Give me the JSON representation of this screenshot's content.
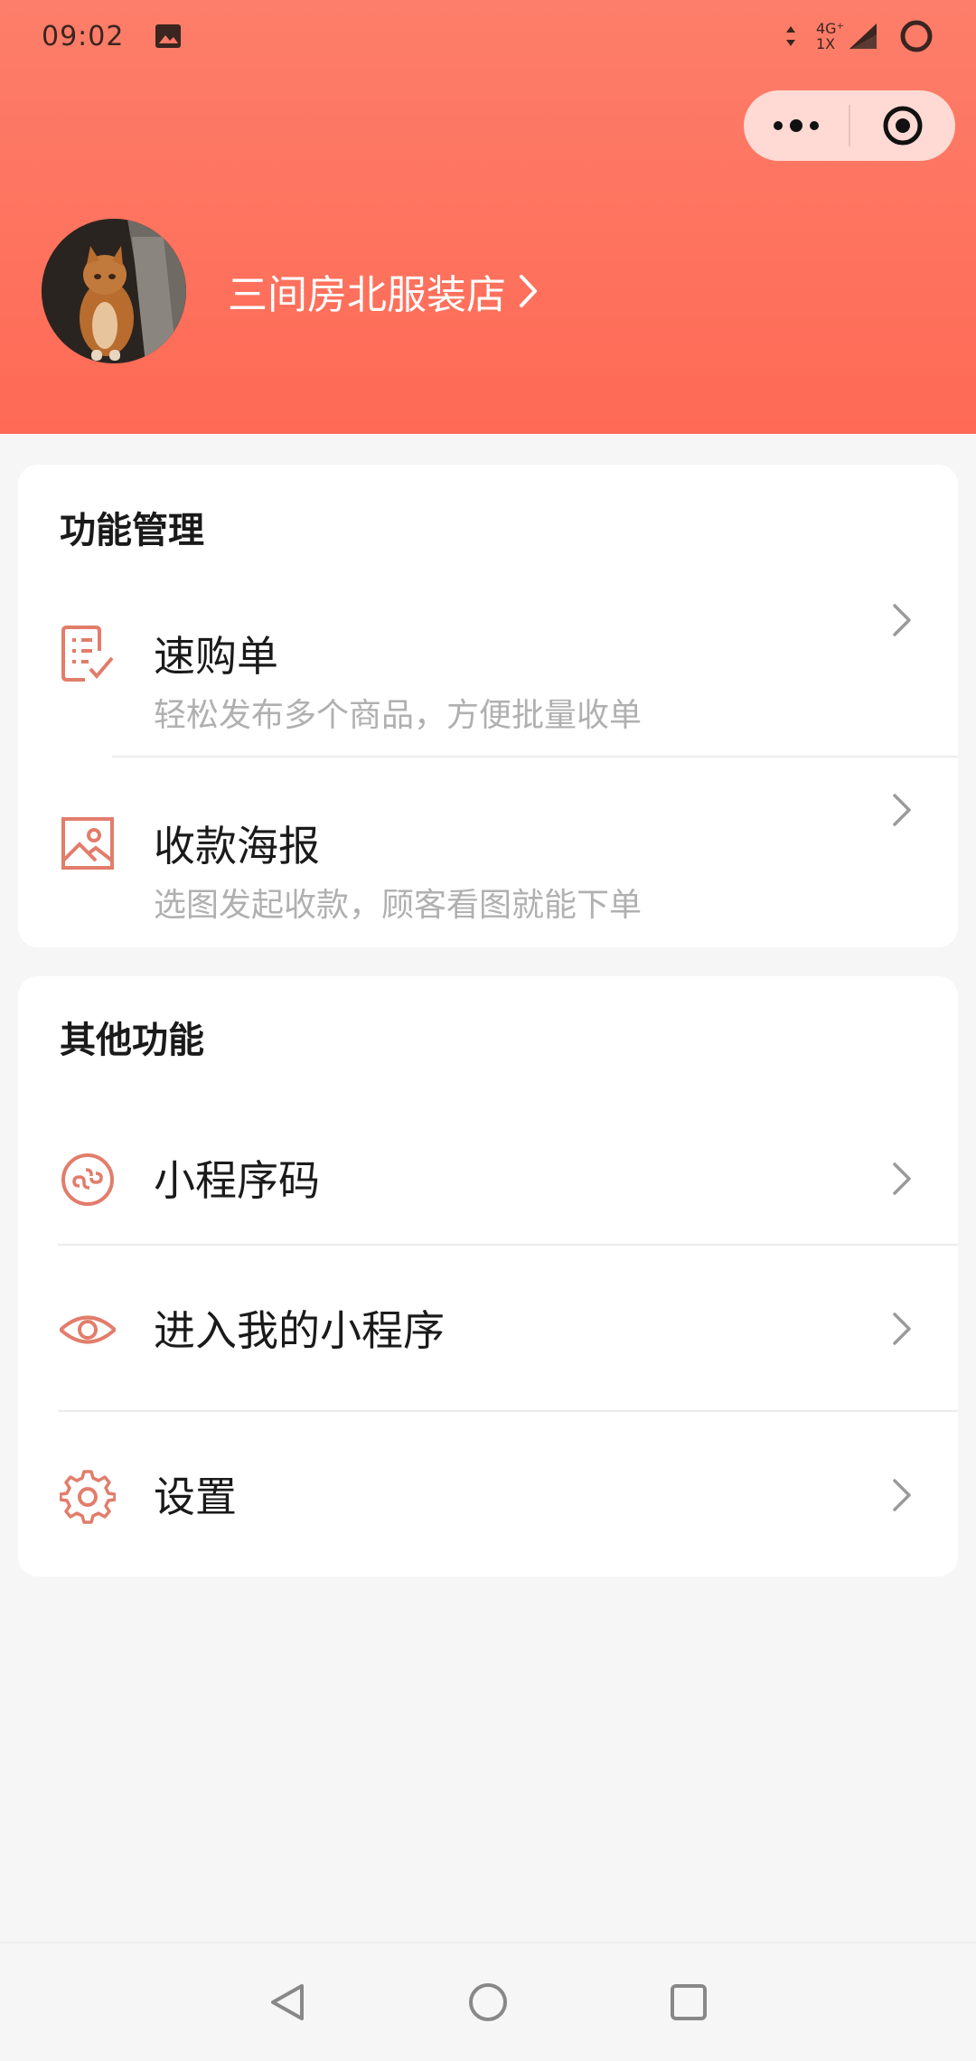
{
  "status_bar": {
    "time": "09:02",
    "network_top": "4G⁺",
    "network_bottom": "1X",
    "icons": [
      "gallery-icon",
      "signal-icon",
      "battery-ring-icon"
    ]
  },
  "capsule": {
    "more_icon": "more-dots-icon",
    "close_icon": "target-icon"
  },
  "profile": {
    "shop_name": "三间房北服装店",
    "avatar_icon": "cat-avatar"
  },
  "colors": {
    "accent": "#fe6a55",
    "icon": "#e27d6b",
    "subtext": "#b0b0b0"
  },
  "section_manage": {
    "title": "功能管理",
    "items": [
      {
        "title": "速购单",
        "subtitle": "轻松发布多个商品，方便批量收单",
        "icon": "checklist-icon"
      },
      {
        "title": "收款海报",
        "subtitle": "选图发起收款，顾客看图就能下单",
        "icon": "image-icon"
      }
    ]
  },
  "section_other": {
    "title": "其他功能",
    "items": [
      {
        "title": "小程序码",
        "icon": "miniprogram-icon"
      },
      {
        "title": "进入我的小程序",
        "icon": "eye-icon"
      },
      {
        "title": "设置",
        "icon": "gear-icon"
      }
    ]
  },
  "nav": {
    "back_icon": "back-triangle-icon",
    "home_icon": "home-circle-icon",
    "recent_icon": "recent-square-icon"
  }
}
